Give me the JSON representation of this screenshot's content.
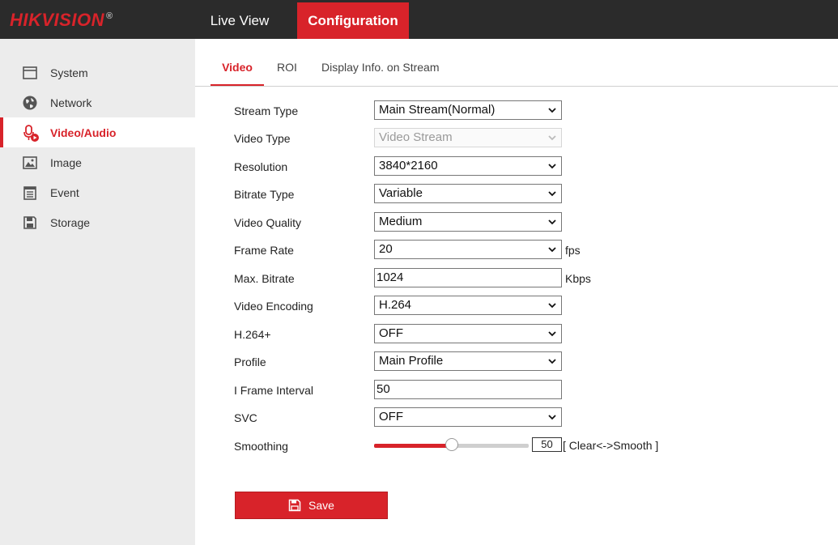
{
  "header": {
    "logo": "HIKVISION",
    "logo_mark": "®",
    "tabs": [
      {
        "label": "Live View"
      },
      {
        "label": "Configuration"
      }
    ]
  },
  "sidebar": {
    "items": [
      {
        "label": "System",
        "icon": "monitor-icon"
      },
      {
        "label": "Network",
        "icon": "globe-icon"
      },
      {
        "label": "Video/Audio",
        "icon": "microphone-icon"
      },
      {
        "label": "Image",
        "icon": "image-icon"
      },
      {
        "label": "Event",
        "icon": "calendar-icon"
      },
      {
        "label": "Storage",
        "icon": "floppy-disk-icon"
      }
    ],
    "active": "Video/Audio"
  },
  "subtabs": [
    {
      "label": "Video"
    },
    {
      "label": "ROI"
    },
    {
      "label": "Display Info. on Stream"
    }
  ],
  "form": {
    "stream_type": {
      "label": "Stream Type",
      "value": "Main Stream(Normal)"
    },
    "video_type": {
      "label": "Video Type",
      "value": "Video Stream"
    },
    "resolution": {
      "label": "Resolution",
      "value": "3840*2160"
    },
    "bitrate_type": {
      "label": "Bitrate Type",
      "value": "Variable"
    },
    "video_quality": {
      "label": "Video Quality",
      "value": "Medium"
    },
    "frame_rate": {
      "label": "Frame Rate",
      "value": "20",
      "unit": "fps"
    },
    "max_bitrate": {
      "label": "Max. Bitrate",
      "value": "1024",
      "unit": "Kbps"
    },
    "video_encoding": {
      "label": "Video Encoding",
      "value": "H.264"
    },
    "h264_plus": {
      "label": "H.264+",
      "value": "OFF"
    },
    "profile": {
      "label": "Profile",
      "value": "Main Profile"
    },
    "i_frame_interval": {
      "label": "I Frame Interval",
      "value": "50"
    },
    "svc": {
      "label": "SVC",
      "value": "OFF"
    },
    "smoothing": {
      "label": "Smoothing",
      "value": "50",
      "level": 0.5,
      "hint": "[ Clear<->Smooth ]"
    }
  },
  "save_label": "Save",
  "colors": {
    "accent": "#d8232a",
    "topbar": "#2b2b2b",
    "sidebar_bg": "#ececec"
  }
}
